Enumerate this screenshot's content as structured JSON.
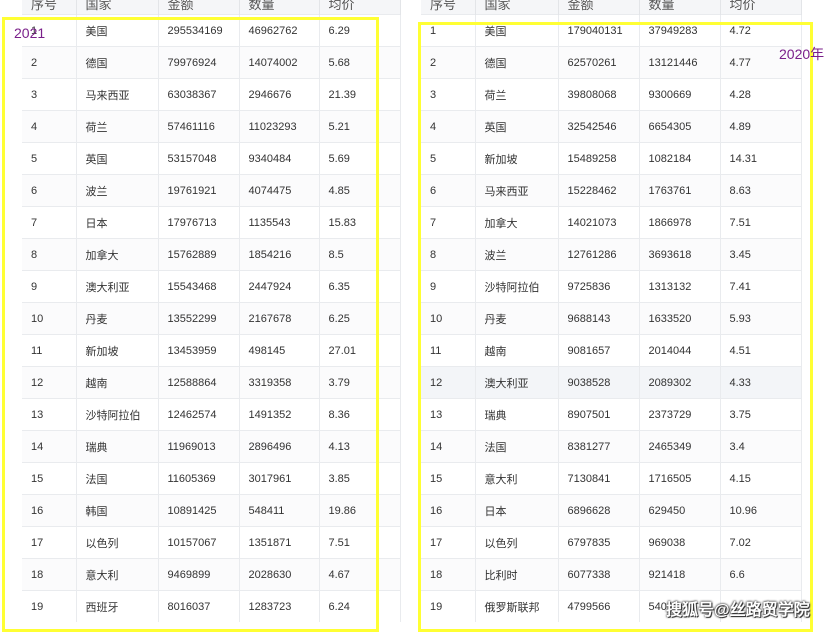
{
  "columns": [
    "序号",
    "国家",
    "金额",
    "数量",
    "均价"
  ],
  "left": {
    "year": "2021",
    "rows": [
      [
        "1",
        "美国",
        "295534169",
        "46962762",
        "6.29"
      ],
      [
        "2",
        "德国",
        "79976924",
        "14074002",
        "5.68"
      ],
      [
        "3",
        "马来西亚",
        "63038367",
        "2946676",
        "21.39"
      ],
      [
        "4",
        "荷兰",
        "57461116",
        "11023293",
        "5.21"
      ],
      [
        "5",
        "英国",
        "53157048",
        "9340484",
        "5.69"
      ],
      [
        "6",
        "波兰",
        "19761921",
        "4074475",
        "4.85"
      ],
      [
        "7",
        "日本",
        "17976713",
        "1135543",
        "15.83"
      ],
      [
        "8",
        "加拿大",
        "15762889",
        "1854216",
        "8.5"
      ],
      [
        "9",
        "澳大利亚",
        "15543468",
        "2447924",
        "6.35"
      ],
      [
        "10",
        "丹麦",
        "13552299",
        "2167678",
        "6.25"
      ],
      [
        "11",
        "新加坡",
        "13453959",
        "498145",
        "27.01"
      ],
      [
        "12",
        "越南",
        "12588864",
        "3319358",
        "3.79"
      ],
      [
        "13",
        "沙特阿拉伯",
        "12462574",
        "1491352",
        "8.36"
      ],
      [
        "14",
        "瑞典",
        "11969013",
        "2896496",
        "4.13"
      ],
      [
        "15",
        "法国",
        "11605369",
        "3017961",
        "3.85"
      ],
      [
        "16",
        "韩国",
        "10891425",
        "548411",
        "19.86"
      ],
      [
        "17",
        "以色列",
        "10157067",
        "1351871",
        "7.51"
      ],
      [
        "18",
        "意大利",
        "9469899",
        "2028630",
        "4.67"
      ],
      [
        "19",
        "西班牙",
        "8016037",
        "1283723",
        "6.24"
      ]
    ]
  },
  "right": {
    "year": "2020年",
    "rows": [
      [
        "1",
        "美国",
        "179040131",
        "37949283",
        "4.72"
      ],
      [
        "2",
        "德国",
        "62570261",
        "13121446",
        "4.77"
      ],
      [
        "3",
        "荷兰",
        "39808068",
        "9300669",
        "4.28"
      ],
      [
        "4",
        "英国",
        "32542546",
        "6654305",
        "4.89"
      ],
      [
        "5",
        "新加坡",
        "15489258",
        "1082184",
        "14.31"
      ],
      [
        "6",
        "马来西亚",
        "15228462",
        "1763761",
        "8.63"
      ],
      [
        "7",
        "加拿大",
        "14021073",
        "1866978",
        "7.51"
      ],
      [
        "8",
        "波兰",
        "12761286",
        "3693618",
        "3.45"
      ],
      [
        "9",
        "沙特阿拉伯",
        "9725836",
        "1313132",
        "7.41"
      ],
      [
        "10",
        "丹麦",
        "9688143",
        "1633520",
        "5.93"
      ],
      [
        "11",
        "越南",
        "9081657",
        "2014044",
        "4.51"
      ],
      [
        "12",
        "澳大利亚",
        "9038528",
        "2089302",
        "4.33"
      ],
      [
        "13",
        "瑞典",
        "8907501",
        "2373729",
        "3.75"
      ],
      [
        "14",
        "法国",
        "8381277",
        "2465349",
        "3.4"
      ],
      [
        "15",
        "意大利",
        "7130841",
        "1716505",
        "4.15"
      ],
      [
        "16",
        "日本",
        "6896628",
        "629450",
        "10.96"
      ],
      [
        "17",
        "以色列",
        "6797835",
        "969038",
        "7.02"
      ],
      [
        "18",
        "比利时",
        "6077338",
        "921418",
        "6.6"
      ],
      [
        "19",
        "俄罗斯联邦",
        "4799566",
        "540",
        ""
      ]
    ]
  },
  "watermark": "搜狐号@丝路贸学院"
}
